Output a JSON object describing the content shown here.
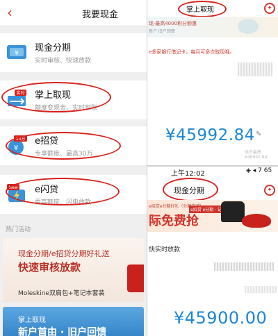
{
  "left": {
    "header": {
      "back_icon": "chevron-left-icon",
      "title": "我要现金"
    },
    "items": [
      {
        "title": "现金分期",
        "subtitle": "实时审核、快速放款",
        "icon": "cash-card-icon"
      },
      {
        "title": "掌上取现",
        "subtitle": "额度变现金、实时到账",
        "icon": "cash-withdraw-icon",
        "badge": "实时"
      },
      {
        "title": "e招贷",
        "subtitle": "专享额度、最高30万",
        "icon": "loan-coin-icon",
        "badge": "30万"
      },
      {
        "title": "e闪贷",
        "subtitle": "更高额度、闪电放款",
        "icon": "flash-loan-icon",
        "badge": "New"
      }
    ],
    "hot_section": "热门活动",
    "card1": {
      "line1": "现金分期/e招贷分期好礼送",
      "line2": "快速审核放款",
      "line3": "Moleskine双肩包+笔记本套装"
    },
    "card2": {
      "line1": "掌上取现",
      "line2": "新户首由 · 旧户回馈"
    }
  },
  "right_top": {
    "title": "掌上取现",
    "banner_text": "现·最高4000积分额惠",
    "banner_sub": "新户·旧户回馈",
    "note": "e多家银行借记卡，每月可多次取现哦。",
    "amount": "¥45992.84",
    "footer": "当日最高 ¥46992.84"
  },
  "right_bottom": {
    "status_time": "上午12:02",
    "status_signal": "◈ ◂ 7 65",
    "title": "现金分期",
    "ad_small": "e招贷e分期好礼（分期立减）",
    "ad_big": "际免费抢",
    "ad_tag": "e招贷 e分期 · 记本套装",
    "subtitle": "快实时放款",
    "amount": "¥45900.00"
  },
  "colors": {
    "accent_red": "#d8221c",
    "amount_blue": "#1a86d6"
  }
}
